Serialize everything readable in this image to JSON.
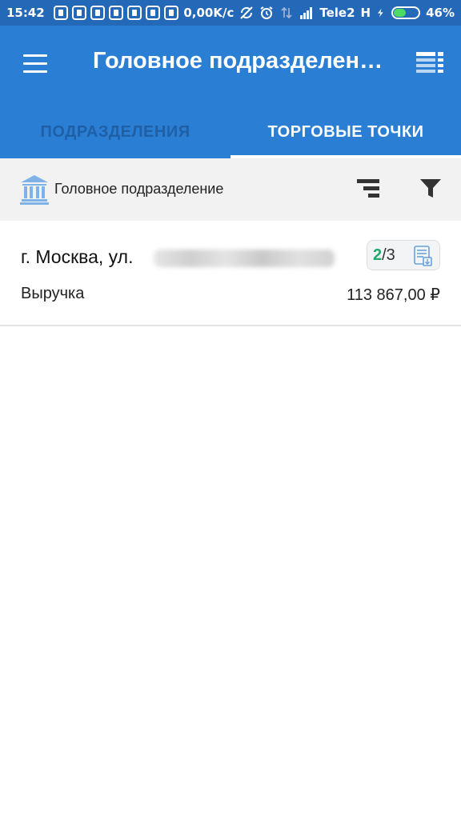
{
  "status_bar": {
    "time": "15:42",
    "speed": "0,00K/c",
    "carrier": "Tele2",
    "network": "H",
    "battery": "46%",
    "battery_level": 0.46
  },
  "app_bar": {
    "title": "Головное подразделен…",
    "tabs": [
      {
        "label": "ПОДРАЗДЕЛЕНИЯ",
        "active": false
      },
      {
        "label": "ТОРГОВЫЕ ТОЧКИ",
        "active": true
      }
    ]
  },
  "filter": {
    "label": "Головное подразделение"
  },
  "items": [
    {
      "address": "г. Москва, ул.",
      "count_done": "2",
      "count_total": "/3",
      "revenue_label": "Выручка",
      "revenue_value": "113 867,00 ₽"
    }
  ],
  "colors": {
    "status_bar": "#2468b8",
    "app_bar": "#2a7fd4",
    "tab_inactive": "#1f5fa6",
    "accent_green": "#1fa96b",
    "filter_bar": "#f2f2f2"
  }
}
